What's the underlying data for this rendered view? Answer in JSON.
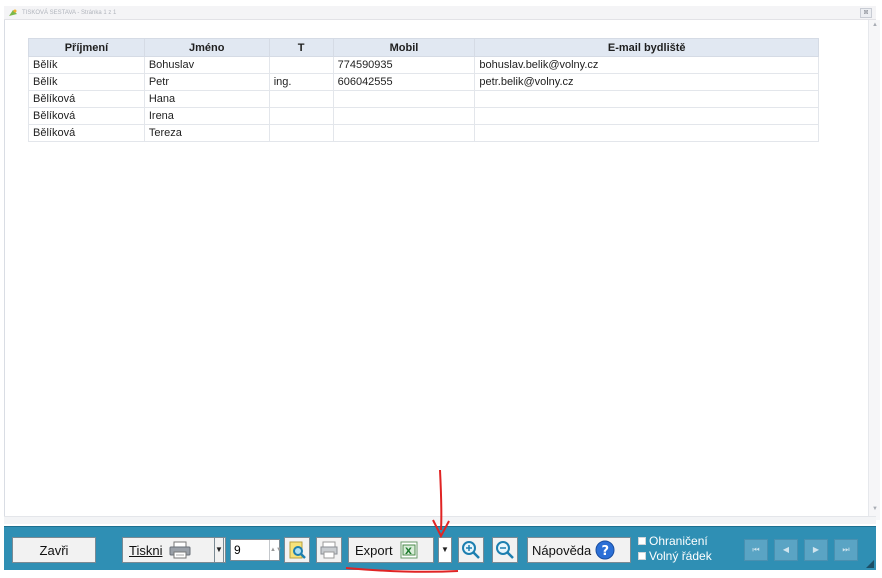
{
  "window": {
    "title": "TISKOVÁ SESTAVA - Stránka 1 z 1",
    "close_glyph": "⊠"
  },
  "table": {
    "columns": [
      "Příjmení",
      "Jméno",
      "T",
      "Mobil",
      "E-mail bydliště"
    ],
    "rows": [
      [
        "Bělík",
        "Bohuslav",
        "",
        "774590935",
        "bohuslav.belik@volny.cz"
      ],
      [
        "Bělík",
        "Petr",
        "ing.",
        "606042555",
        "petr.belik@volny.cz"
      ],
      [
        "Bělíková",
        "Hana",
        "",
        "",
        ""
      ],
      [
        "Bělíková",
        "Irena",
        "",
        "",
        ""
      ],
      [
        "Bělíková",
        "Tereza",
        "",
        "",
        ""
      ]
    ]
  },
  "toolbar": {
    "close_label": "Zavři",
    "print_label": "Tiskni",
    "copies_value": "9",
    "export_label": "Export",
    "help_label": "Nápověda",
    "checkbox_border_label": "Ohraničení",
    "checkbox_blank_row_label": "Volný řádek",
    "nav_first": "⏮",
    "nav_prev": "◀",
    "nav_next": "▶",
    "nav_last": "⏭",
    "dropdown_glyph": "▼"
  },
  "icons": {
    "printer": "printer-icon",
    "preview": "print-preview-icon",
    "page_setup": "page-setup-icon",
    "excel": "excel-icon",
    "zoom_in": "zoom-in-icon",
    "zoom_out": "zoom-out-icon",
    "help": "help-icon"
  },
  "colors": {
    "toolbar_bg": "#2f8fb4",
    "header_bg": "#e1e8f2",
    "annotation_red": "#e02424"
  }
}
